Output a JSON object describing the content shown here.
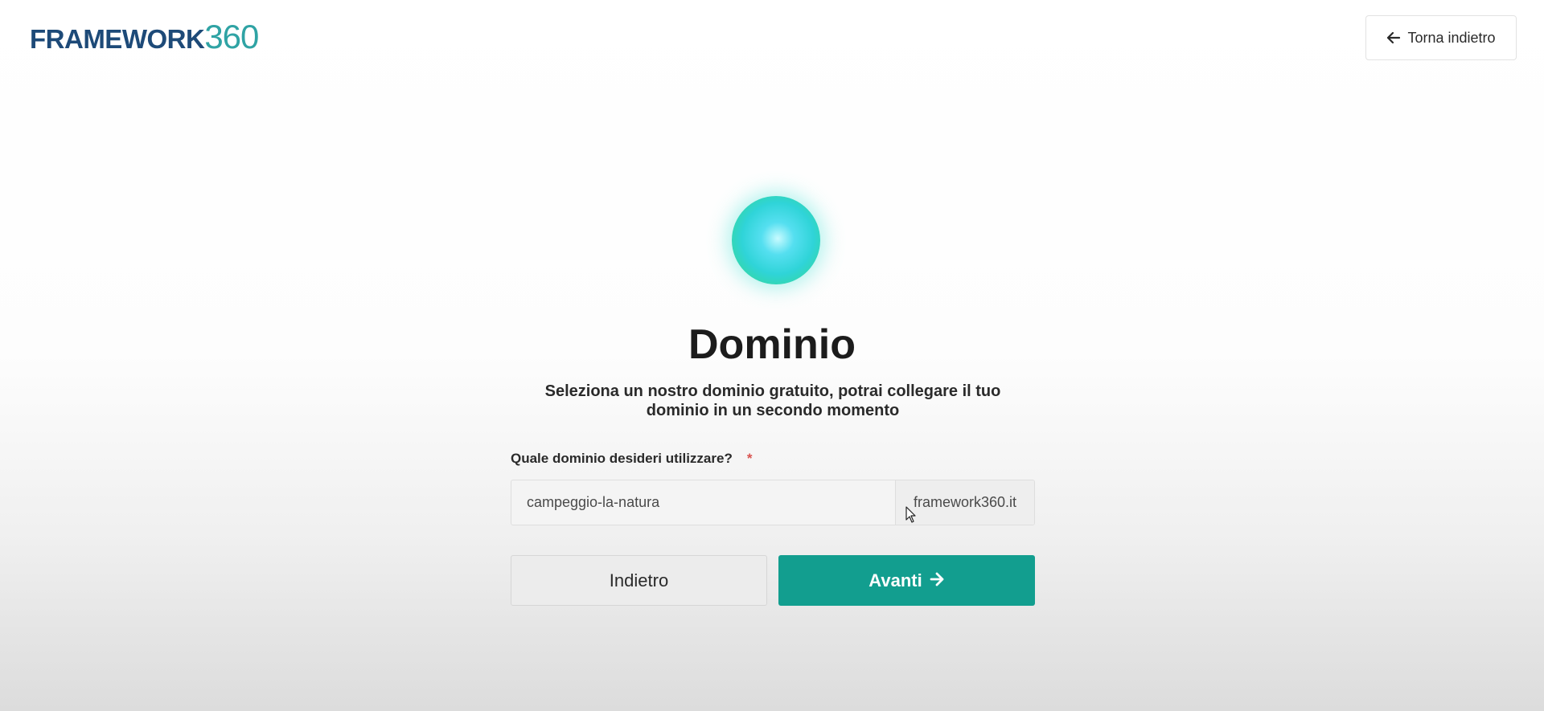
{
  "header": {
    "logo_word": "FRAMEWORK",
    "logo_number": "360",
    "back_label": "Torna indietro",
    "back_icon": "arrow-left-icon"
  },
  "main": {
    "title": "Dominio",
    "subtitle": "Seleziona un nostro dominio gratuito, potrai collegare il tuo dominio in un secondo momento",
    "field_label": "Quale dominio desideri utilizzare?",
    "required_mark": "*",
    "domain_value": "campeggio-la-natura",
    "domain_suffix": "framework360.it",
    "prev_label": "Indietro",
    "next_label": "Avanti",
    "next_icon": "arrow-right-icon"
  },
  "colors": {
    "brand_dark": "#1d4a78",
    "brand_teal": "#2fa3a4",
    "primary_button": "#129e8f",
    "required": "#d9534f"
  }
}
